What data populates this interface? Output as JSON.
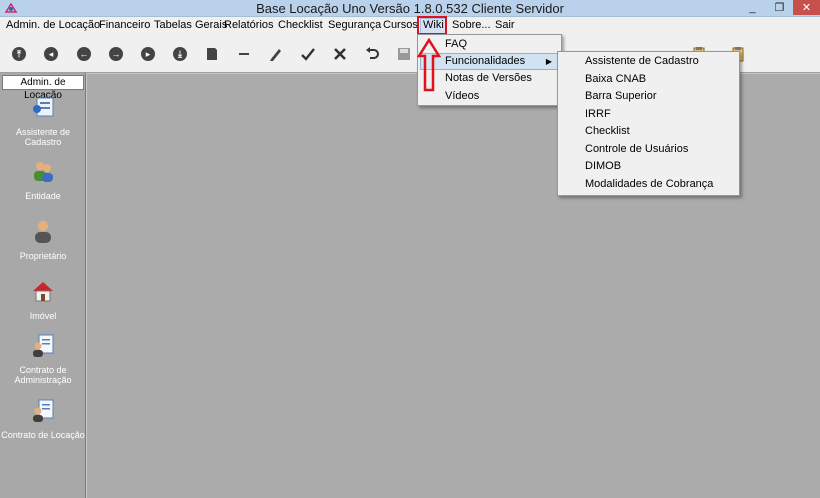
{
  "window": {
    "title": "Base Locação Uno Versão 1.8.0.532 Cliente Servidor",
    "minimize": "_",
    "restore": "❐",
    "close": "✕"
  },
  "menubar": {
    "items": [
      {
        "label": "Admin. de Locação"
      },
      {
        "label": "Financeiro"
      },
      {
        "label": "Tabelas Gerais"
      },
      {
        "label": "Relatórios"
      },
      {
        "label": "Checklist"
      },
      {
        "label": "Segurança"
      },
      {
        "label": "Cursos"
      },
      {
        "label": "Wiki"
      },
      {
        "label": "Sobre..."
      },
      {
        "label": "Sair"
      }
    ]
  },
  "wiki_menu": {
    "items": [
      {
        "label": "FAQ"
      },
      {
        "label": "Funcionalidades"
      },
      {
        "label": "Notas de Versões"
      },
      {
        "label": "Vídeos"
      }
    ]
  },
  "funcionalidades_menu": {
    "items": [
      {
        "label": "Assistente de Cadastro"
      },
      {
        "label": "Baixa CNAB"
      },
      {
        "label": "Barra Superior"
      },
      {
        "label": "IRRF"
      },
      {
        "label": "Checklist"
      },
      {
        "label": "Controle de Usuários"
      },
      {
        "label": "DIMOB"
      },
      {
        "label": "Modalidades de Cobrança"
      }
    ]
  },
  "sidepanel": {
    "header": "Admin. de Locação",
    "items": [
      {
        "label": "Assistente de Cadastro",
        "icon": "form-icon"
      },
      {
        "label": "Entidade",
        "icon": "people-icon"
      },
      {
        "label": "Proprietário",
        "icon": "person-icon"
      },
      {
        "label": "Imóvel",
        "icon": "house-icon"
      },
      {
        "label": "Contrato de Administração",
        "icon": "contract-icon"
      },
      {
        "label": "Contrato de Locação",
        "icon": "contract-icon"
      }
    ]
  },
  "colors": {
    "highlight_border": "#e0111d",
    "titlebar": "#b9d1ea",
    "panel": "#a8a8a8",
    "content": "#ababab"
  }
}
